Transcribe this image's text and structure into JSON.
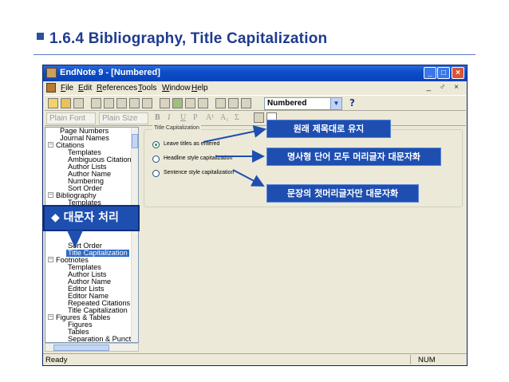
{
  "slide": {
    "title": "1.6.4 Bibliography, Title Capitalization"
  },
  "window": {
    "title": "EndNote 9 - [Numbered]",
    "buttons": [
      "_",
      "□",
      "×"
    ],
    "menu": [
      "File",
      "Edit",
      "References",
      "Tools",
      "Window",
      "Help"
    ],
    "mdi_buttons": "_ ♂ ×",
    "style_select": "Numbered",
    "help_label": "?",
    "font_select": "Plain Font",
    "size_select": "Plain Size",
    "format_buttons": [
      "B",
      "I",
      "U",
      "P",
      "A¹",
      "A₁",
      "Σ"
    ]
  },
  "tree": {
    "items": [
      {
        "label": "Page Numbers",
        "selected": false
      },
      {
        "label": "Journal Names",
        "selected": false
      },
      {
        "label": "Citations",
        "selected": false
      },
      {
        "label": "Templates",
        "selected": false
      },
      {
        "label": "Ambiguous Citations",
        "selected": false
      },
      {
        "label": "Author Lists",
        "selected": false
      },
      {
        "label": "Author Name",
        "selected": false
      },
      {
        "label": "Numbering",
        "selected": false
      },
      {
        "label": "Sort Order",
        "selected": false
      },
      {
        "label": "Bibliography",
        "selected": false
      },
      {
        "label": "Templates",
        "selected": false
      },
      {
        "label": "Sort Order",
        "selected": false
      },
      {
        "label": "Title Capitalization",
        "selected": true
      },
      {
        "label": "Footnotes",
        "selected": false
      },
      {
        "label": "Templates",
        "selected": false
      },
      {
        "label": "Author Lists",
        "selected": false
      },
      {
        "label": "Author Name",
        "selected": false
      },
      {
        "label": "Editor Lists",
        "selected": false
      },
      {
        "label": "Editor Name",
        "selected": false
      },
      {
        "label": "Repeated Citations",
        "selected": false
      },
      {
        "label": "Title Capitalization",
        "selected": false
      },
      {
        "label": "Figures & Tables",
        "selected": false
      },
      {
        "label": "Figures",
        "selected": false
      },
      {
        "label": "Tables",
        "selected": false
      },
      {
        "label": "Separation & Punctu",
        "selected": false
      }
    ]
  },
  "main": {
    "group_title": "Title Capitalization",
    "options": [
      {
        "label": "Leave titles as entered",
        "checked": true
      },
      {
        "label": "Headline style capitalization",
        "checked": false
      },
      {
        "label": "Sentence style capitalization",
        "checked": false
      }
    ]
  },
  "status": {
    "left": "Ready",
    "right": "NUM"
  },
  "callouts": {
    "keep_original": "원래 제목대로 유지",
    "headline": "명사형 단어 모두 머리글자 대문자화",
    "sentence": "문장의 첫머리글자만 대문자화",
    "badge": "◆ 대문자 처리"
  },
  "colors": {
    "callout_bg": "#1e4fb0",
    "title_color": "#1f3b8f",
    "selection": "#316ac5"
  }
}
